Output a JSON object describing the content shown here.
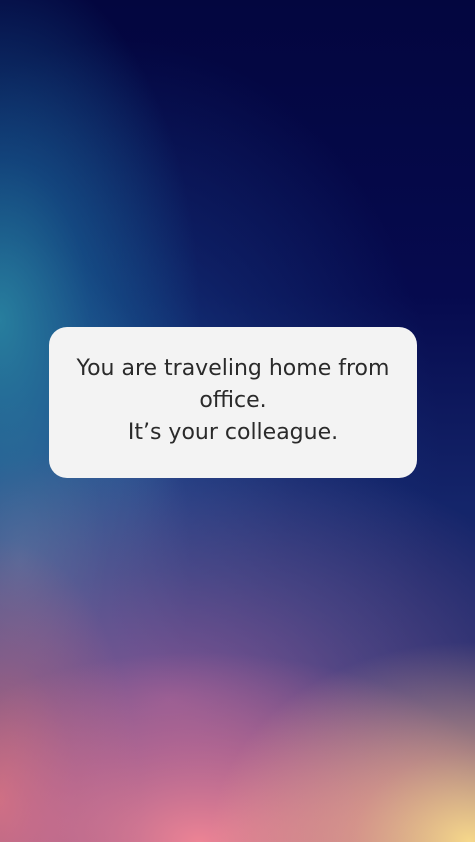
{
  "message": {
    "lines": [
      "You are traveling home from",
      "office.",
      "It’s your colleague."
    ]
  },
  "colors": {
    "card_background": "#f3f3f3",
    "text": "#2a2a2a",
    "background_top": "#03063f"
  }
}
